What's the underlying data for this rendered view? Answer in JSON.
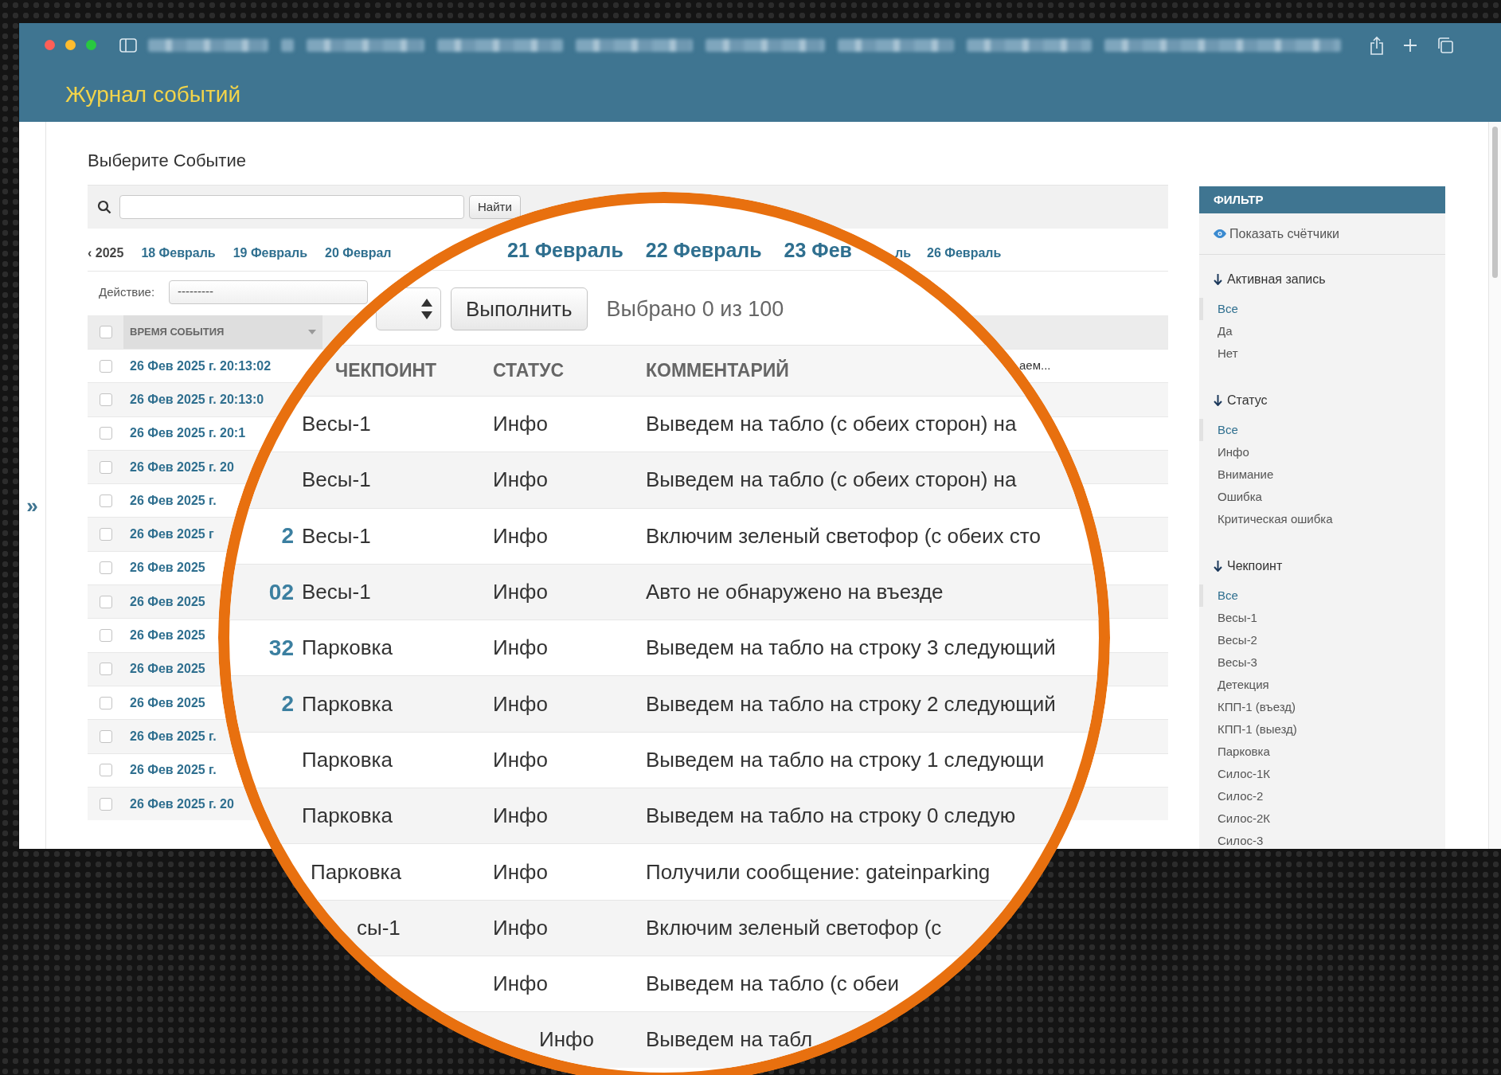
{
  "header": {
    "title": "Журнал событий"
  },
  "gutter": {
    "toggle": "»"
  },
  "page_title": "Выберите Событие",
  "search": {
    "button": "Найти"
  },
  "date_nav": {
    "left": [
      {
        "label": "‹ 2025",
        "kind": "year"
      },
      {
        "label": "18 Февраль",
        "kind": "link"
      },
      {
        "label": "19 Февраль",
        "kind": "link"
      },
      {
        "label": "20 Феврал",
        "kind": "link"
      }
    ],
    "right": [
      {
        "label": "ль",
        "kind": "link"
      },
      {
        "label": "26 Февраль",
        "kind": "link"
      }
    ]
  },
  "action": {
    "label": "Действие:",
    "value": "---------"
  },
  "table": {
    "header": {
      "checked": false,
      "column": "ВРЕМЯ СОБЫТИЯ"
    },
    "rows": [
      {
        "checked": false,
        "time": "26 Фев 2025 г. 20:13:02",
        "comment": "аем..."
      },
      {
        "checked": false,
        "time": "26 Фев 2025 г. 20:13:0"
      },
      {
        "checked": false,
        "time": "26 Фев 2025 г. 20:1"
      },
      {
        "checked": false,
        "time": "26 Фев 2025 г. 20"
      },
      {
        "checked": false,
        "time": "26 Фев 2025 г."
      },
      {
        "checked": false,
        "time": "26 Фев 2025 г"
      },
      {
        "checked": false,
        "time": "26 Фев 2025"
      },
      {
        "checked": false,
        "time": "26 Фев 2025"
      },
      {
        "checked": false,
        "time": "26 Фев 2025"
      },
      {
        "checked": false,
        "time": "26 Фев 2025"
      },
      {
        "checked": false,
        "time": "26 Фев 2025"
      },
      {
        "checked": false,
        "time": "26 Фев 2025 г."
      },
      {
        "checked": false,
        "time": "26 Фев 2025 г."
      },
      {
        "checked": false,
        "time": "26 Фев 2025 г. 20"
      }
    ]
  },
  "magnifier": {
    "dates": [
      {
        "label": "21 Февраль"
      },
      {
        "label": "22 Февраль"
      },
      {
        "label": "23 Фев"
      }
    ],
    "execute_button": "Выполнить",
    "selection_count": "Выбрано 0 из 100",
    "columns": [
      "ЧЕКПОИНТ",
      "СТАТУС",
      "КОММЕНТАРИЙ"
    ],
    "rows": [
      {
        "checkpoint": "Весы-1",
        "status": "Инфо",
        "comment": "Выведем на табло (с обеих сторон) на"
      },
      {
        "checkpoint": "Весы-1",
        "status": "Инфо",
        "comment": "Выведем на табло (с обеих сторон) на"
      },
      {
        "time": "2",
        "checkpoint": "Весы-1",
        "status": "Инфо",
        "comment": "Включим зеленый светофор (с обеих сто"
      },
      {
        "time": "02",
        "checkpoint": "Весы-1",
        "status": "Инфо",
        "comment": "Авто не обнаружено на въезде"
      },
      {
        "time": "32",
        "checkpoint": "Парковка",
        "status": "Инфо",
        "comment": "Выведем на табло на строку 3 следующий"
      },
      {
        "time": "2",
        "checkpoint": "Парковка",
        "status": "Инфо",
        "comment": "Выведем на табло на строку 2 следующий"
      },
      {
        "checkpoint": "Парковка",
        "status": "Инфо",
        "comment": "Выведем на табло на строку 1 следующи"
      },
      {
        "checkpoint": "Парковка",
        "status": "Инфо",
        "comment": "Выведем на табло на строку 0 следую"
      },
      {
        "checkpoint": "Парковка",
        "status": "Инфо",
        "comment": "Получили сообщение: gateinparking"
      },
      {
        "checkpoint": "сы-1",
        "status": "Инфо",
        "comment": "Включим зеленый светофор (с"
      },
      {
        "status": "Инфо",
        "comment": "Выведем на табло (с обеи"
      },
      {
        "status": "Инфо",
        "comment": "Выведем на табл"
      }
    ]
  },
  "filter": {
    "title": "ФИЛЬТР",
    "show_counters": "Показать счётчики",
    "groups": [
      {
        "title": "Активная запись",
        "items": [
          {
            "label": "Все",
            "selected": true
          },
          {
            "label": "Да",
            "selected": false
          },
          {
            "label": "Нет",
            "selected": false
          }
        ]
      },
      {
        "title": "Статус",
        "items": [
          {
            "label": "Все",
            "selected": true
          },
          {
            "label": "Инфо",
            "selected": false
          },
          {
            "label": "Внимание",
            "selected": false
          },
          {
            "label": "Ошибка",
            "selected": false
          },
          {
            "label": "Критическая ошибка",
            "selected": false
          }
        ]
      },
      {
        "title": "Чекпоинт",
        "items": [
          {
            "label": "Все",
            "selected": true
          },
          {
            "label": "Весы-1",
            "selected": false
          },
          {
            "label": "Весы-2",
            "selected": false
          },
          {
            "label": "Весы-3",
            "selected": false
          },
          {
            "label": "Детекция",
            "selected": false
          },
          {
            "label": "КПП-1 (въезд)",
            "selected": false
          },
          {
            "label": "КПП-1 (выезд)",
            "selected": false
          },
          {
            "label": "Парковка",
            "selected": false
          },
          {
            "label": "Силос-1К",
            "selected": false
          },
          {
            "label": "Силос-2",
            "selected": false
          },
          {
            "label": "Силос-2К",
            "selected": false
          },
          {
            "label": "Силос-3",
            "selected": false
          }
        ]
      }
    ]
  }
}
